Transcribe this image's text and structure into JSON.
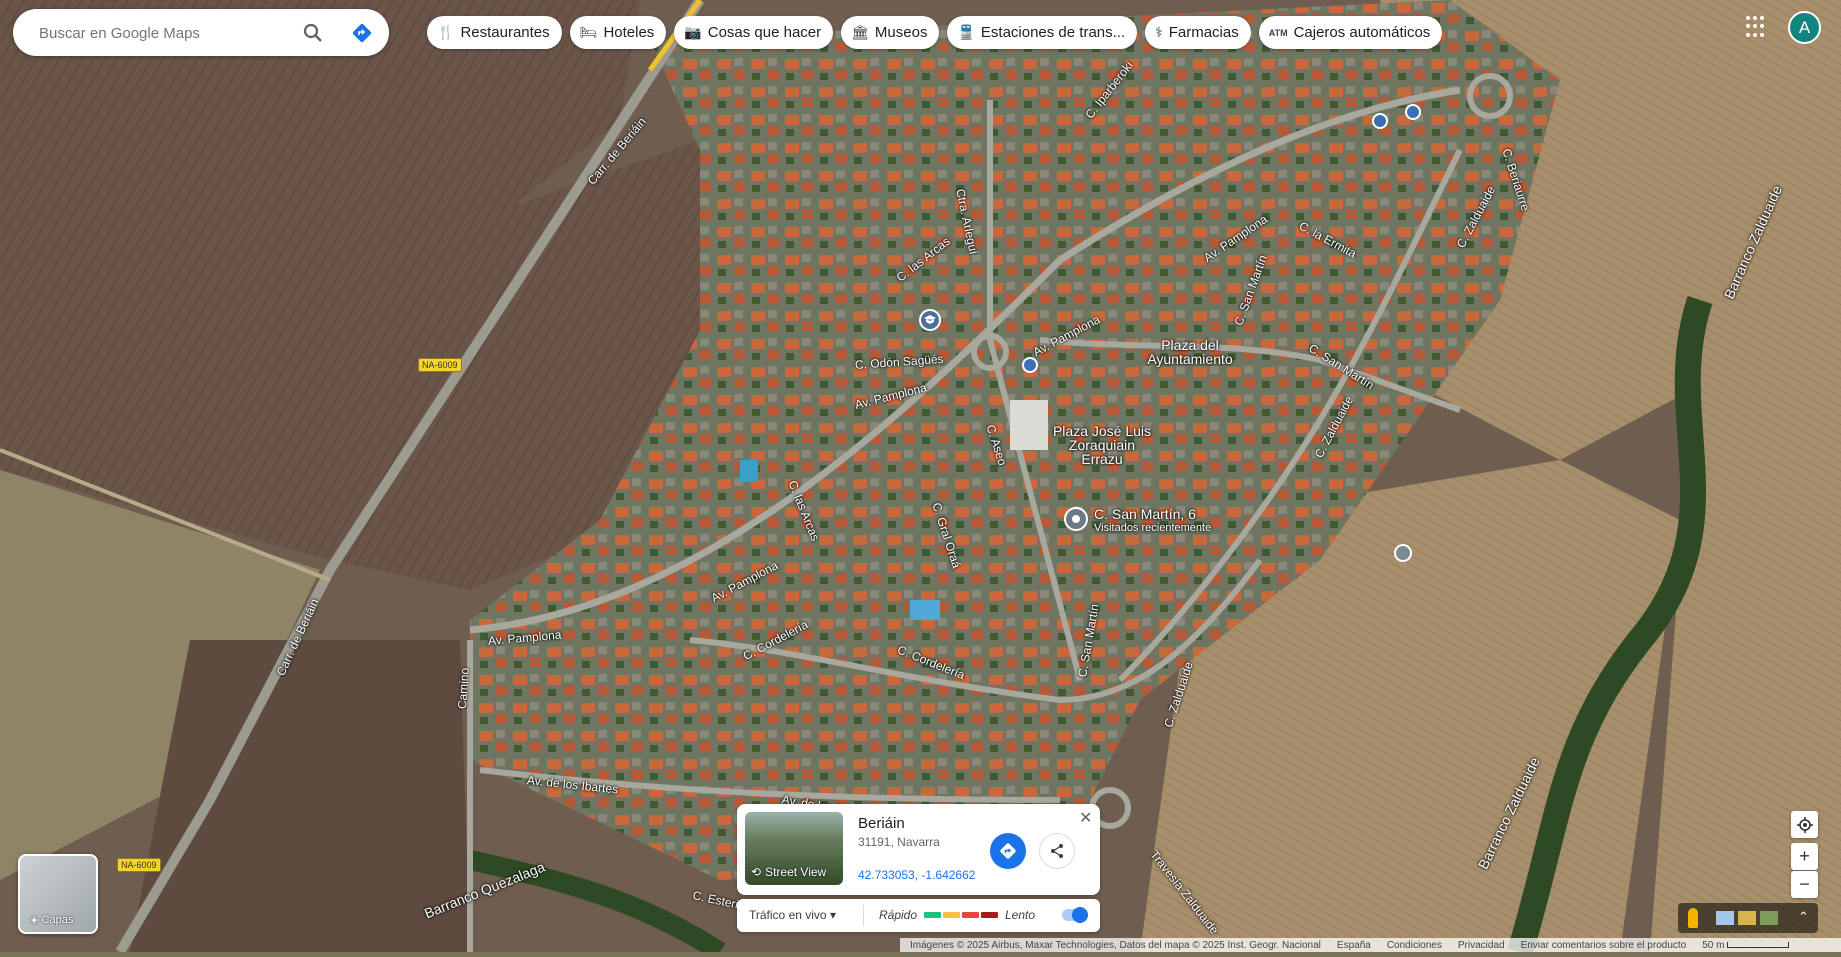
{
  "search": {
    "placeholder": "Buscar en Google Maps"
  },
  "chips": [
    {
      "icon": "restaurant-icon",
      "label": "Restaurantes"
    },
    {
      "icon": "hotel-icon",
      "label": "Hoteles"
    },
    {
      "icon": "camera-icon",
      "label": "Cosas que hacer"
    },
    {
      "icon": "museum-icon",
      "label": "Museos"
    },
    {
      "icon": "transit-icon",
      "label": "Estaciones de trans..."
    },
    {
      "icon": "pharmacy-icon",
      "label": "Farmacias"
    },
    {
      "icon": "atm-icon",
      "label": "Cajeros automáticos"
    }
  ],
  "account": {
    "initial": "A"
  },
  "map_labels": {
    "carr_beriain_top": "Carr. de Beriáin",
    "carr_beriain_left": "Carr. de Beriáin",
    "na6009_a": "NA-6009",
    "na6009_b": "NA-6009",
    "c_iparberoki": "C. Iparberoki",
    "ctra_arleguí": "Ctra. Arleguí",
    "c_las_arcas_top": "C. las Arcas",
    "c_odon_sagues": "C. Odón Sagüés",
    "av_pamplona_1": "Av. Pamplona",
    "av_pamplona_2": "Av. Pamplona",
    "av_pamplona_3": "Av. Pamplona",
    "av_pamplona_4": "Av. Pamplona",
    "av_pamplona_5": "Av. Pamplona",
    "c_beriaurre": "C. Beriaurre",
    "c_la_ermita": "C. la Ermita",
    "c_zalduaide_1": "C. Zalduaide",
    "c_zalduaide_2": "C. Zalduaide",
    "c_zalduaide_3": "C. Zalduaide",
    "c_san_martin_1": "C. San Martín",
    "c_san_martin_2": "C. San Martín",
    "c_san_martin_3": "C. San Martín",
    "plaza_ayuntamiento": "Plaza del Ayuntamiento",
    "plaza_jose_luis": "Plaza José Luis Zoraquiain Errazu",
    "c_aseo": "C. Aseo",
    "c_las_arcas_2": "C. las Arcas",
    "c_gral_oraa": "C. Gral Oraá",
    "c_corderia_1": "C. Cordelería",
    "c_corderia_2": "C. Cordelería",
    "camino": "Camino",
    "av_ibartes_1": "Av. de los Ibartes",
    "av_ibartes_2": "Av. de los Ibartes",
    "barranco_quezalaga": "Barranco Quezalaga",
    "c_esteriburu": "C. Esteriburu",
    "travesia_zalduaide": "Travesía Zalduaide",
    "barranco_zalduaide_1": "Barranco Zalduaide",
    "barranco_zalduaide_2": "Barranco Zalduaide",
    "pin_title": "C. San Martín, 6",
    "pin_sub": "Visitados recientemente"
  },
  "place_card": {
    "thumbnail_label": "Street View",
    "name": "Beriáin",
    "address": "31191, Navarra",
    "coordinates": "42.733053, -1.642662"
  },
  "traffic": {
    "layer_label": "Tráfico en vivo",
    "fast_label": "Rápido",
    "slow_label": "Lento",
    "legend_colors": [
      "#1ec27a",
      "#f5c242",
      "#e8453c",
      "#a61c1c"
    ],
    "enabled": true
  },
  "layers": {
    "label": "Capas"
  },
  "footer": {
    "attribution": "Imágenes © 2025 Airbus, Maxar Technologies, Datos del mapa © 2025 Inst. Geogr. Nacional",
    "country": "España",
    "terms": "Condiciones",
    "privacy": "Privacidad",
    "feedback": "Enviar comentarios sobre el producto",
    "scale": "50 m"
  },
  "colors": {
    "accent": "#1a73e8",
    "avatar": "#12857f"
  }
}
